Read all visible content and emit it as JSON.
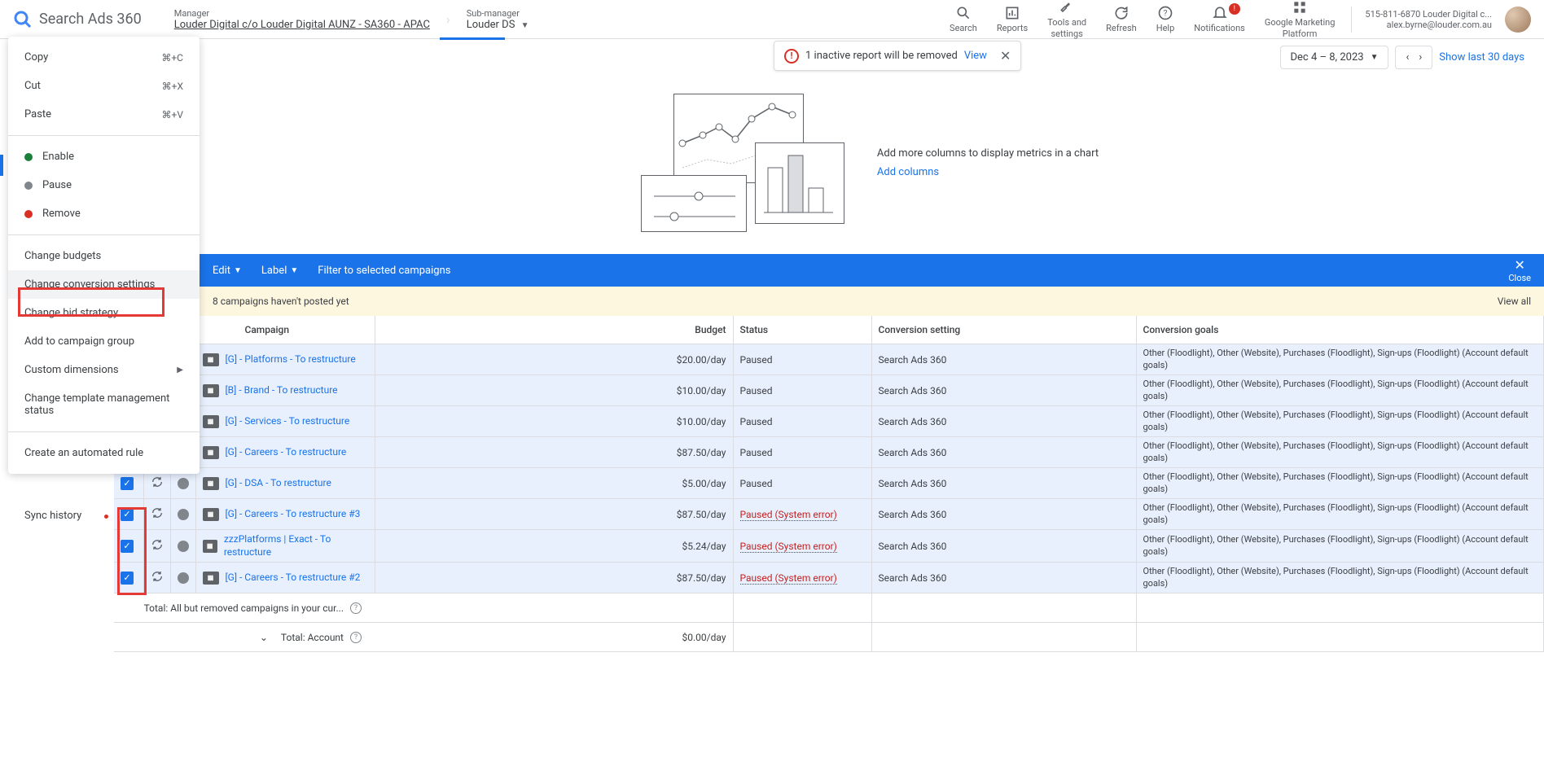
{
  "app": {
    "name": "Search Ads 360"
  },
  "breadcrumbs": {
    "manager_label": "Manager",
    "manager_value": "Louder Digital c/o Louder Digital AUNZ - SA360 - APAC",
    "submanager_label": "Sub-manager",
    "submanager_value": "Louder DS"
  },
  "header_icons": {
    "search": "Search",
    "reports": "Reports",
    "tools": "Tools and\nsettings",
    "refresh": "Refresh",
    "help": "Help",
    "notifications": "Notifications",
    "notif_count": "!",
    "gmp": "Google Marketing\nPlatform"
  },
  "account": {
    "line1": "515-811-6870 Louder Digital c...",
    "line2": "alex.byrne@louder.com.au"
  },
  "toast": {
    "text": "1 inactive report will be removed",
    "link": "View"
  },
  "date": {
    "range": "Dec 4 – 8, 2023",
    "show_last": "Show last 30 days"
  },
  "chart_prompt": {
    "text": "Add more columns to display metrics in a chart",
    "link": "Add columns"
  },
  "blue_bar": {
    "edit": "Edit",
    "label": "Label",
    "filter": "Filter to selected campaigns",
    "close": "Close"
  },
  "yellow": {
    "text": "8 campaigns haven't posted yet",
    "view_all": "View all"
  },
  "menu": {
    "copy": "Copy",
    "copy_sc": "⌘+C",
    "cut": "Cut",
    "cut_sc": "⌘+X",
    "paste": "Paste",
    "paste_sc": "⌘+V",
    "enable": "Enable",
    "pause": "Pause",
    "remove": "Remove",
    "change_budgets": "Change budgets",
    "change_conv": "Change conversion settings",
    "change_bid": "Change bid strategy",
    "add_group": "Add to campaign group",
    "custom_dim": "Custom dimensions",
    "change_tmpl": "Change template management status",
    "create_rule": "Create an automated rule"
  },
  "sidebar": {
    "sync_history": "Sync history"
  },
  "table": {
    "headers": {
      "campaign": "Campaign",
      "budget": "Budget",
      "status": "Status",
      "conv_setting": "Conversion setting",
      "conv_goals": "Conversion goals"
    },
    "rows": [
      {
        "name": "[G] - Platforms - To restructure",
        "budget": "$20.00/day",
        "status": "Paused",
        "error": false,
        "conv": "Search Ads 360",
        "goals": "Other (Floodlight), Other (Website), Purchases (Floodlight), Sign-ups (Floodlight) (Account default goals)"
      },
      {
        "name": "[B] - Brand - To restructure",
        "budget": "$10.00/day",
        "status": "Paused",
        "error": false,
        "conv": "Search Ads 360",
        "goals": "Other (Floodlight), Other (Website), Purchases (Floodlight), Sign-ups (Floodlight) (Account default goals)"
      },
      {
        "name": "[G] - Services - To restructure",
        "budget": "$10.00/day",
        "status": "Paused",
        "error": false,
        "conv": "Search Ads 360",
        "goals": "Other (Floodlight), Other (Website), Purchases (Floodlight), Sign-ups (Floodlight) (Account default goals)"
      },
      {
        "name": "[G] - Careers - To restructure",
        "budget": "$87.50/day",
        "status": "Paused",
        "error": false,
        "conv": "Search Ads 360",
        "goals": "Other (Floodlight), Other (Website), Purchases (Floodlight), Sign-ups (Floodlight) (Account default goals)"
      },
      {
        "name": "[G] - DSA - To restructure",
        "budget": "$5.00/day",
        "status": "Paused",
        "error": false,
        "conv": "Search Ads 360",
        "goals": "Other (Floodlight), Other (Website), Purchases (Floodlight), Sign-ups (Floodlight) (Account default goals)"
      },
      {
        "name": "[G] - Careers - To restructure #3",
        "budget": "$87.50/day",
        "status": "Paused (System error)",
        "error": true,
        "conv": "Search Ads 360",
        "goals": "Other (Floodlight), Other (Website), Purchases (Floodlight), Sign-ups (Floodlight) (Account default goals)"
      },
      {
        "name": "zzzPlatforms | Exact - To restructure",
        "budget": "$5.24/day",
        "status": "Paused (System error)",
        "error": true,
        "conv": "Search Ads 360",
        "goals": "Other (Floodlight), Other (Website), Purchases (Floodlight), Sign-ups (Floodlight) (Account default goals)"
      },
      {
        "name": "[G] - Careers - To restructure #2",
        "budget": "$87.50/day",
        "status": "Paused (System error)",
        "error": true,
        "conv": "Search Ads 360",
        "goals": "Other (Floodlight), Other (Website), Purchases (Floodlight), Sign-ups (Floodlight) (Account default goals)"
      }
    ],
    "totals": {
      "removed": "Total: All but removed campaigns in your cur...",
      "account": "Total: Account",
      "account_budget": "$0.00/day"
    }
  }
}
